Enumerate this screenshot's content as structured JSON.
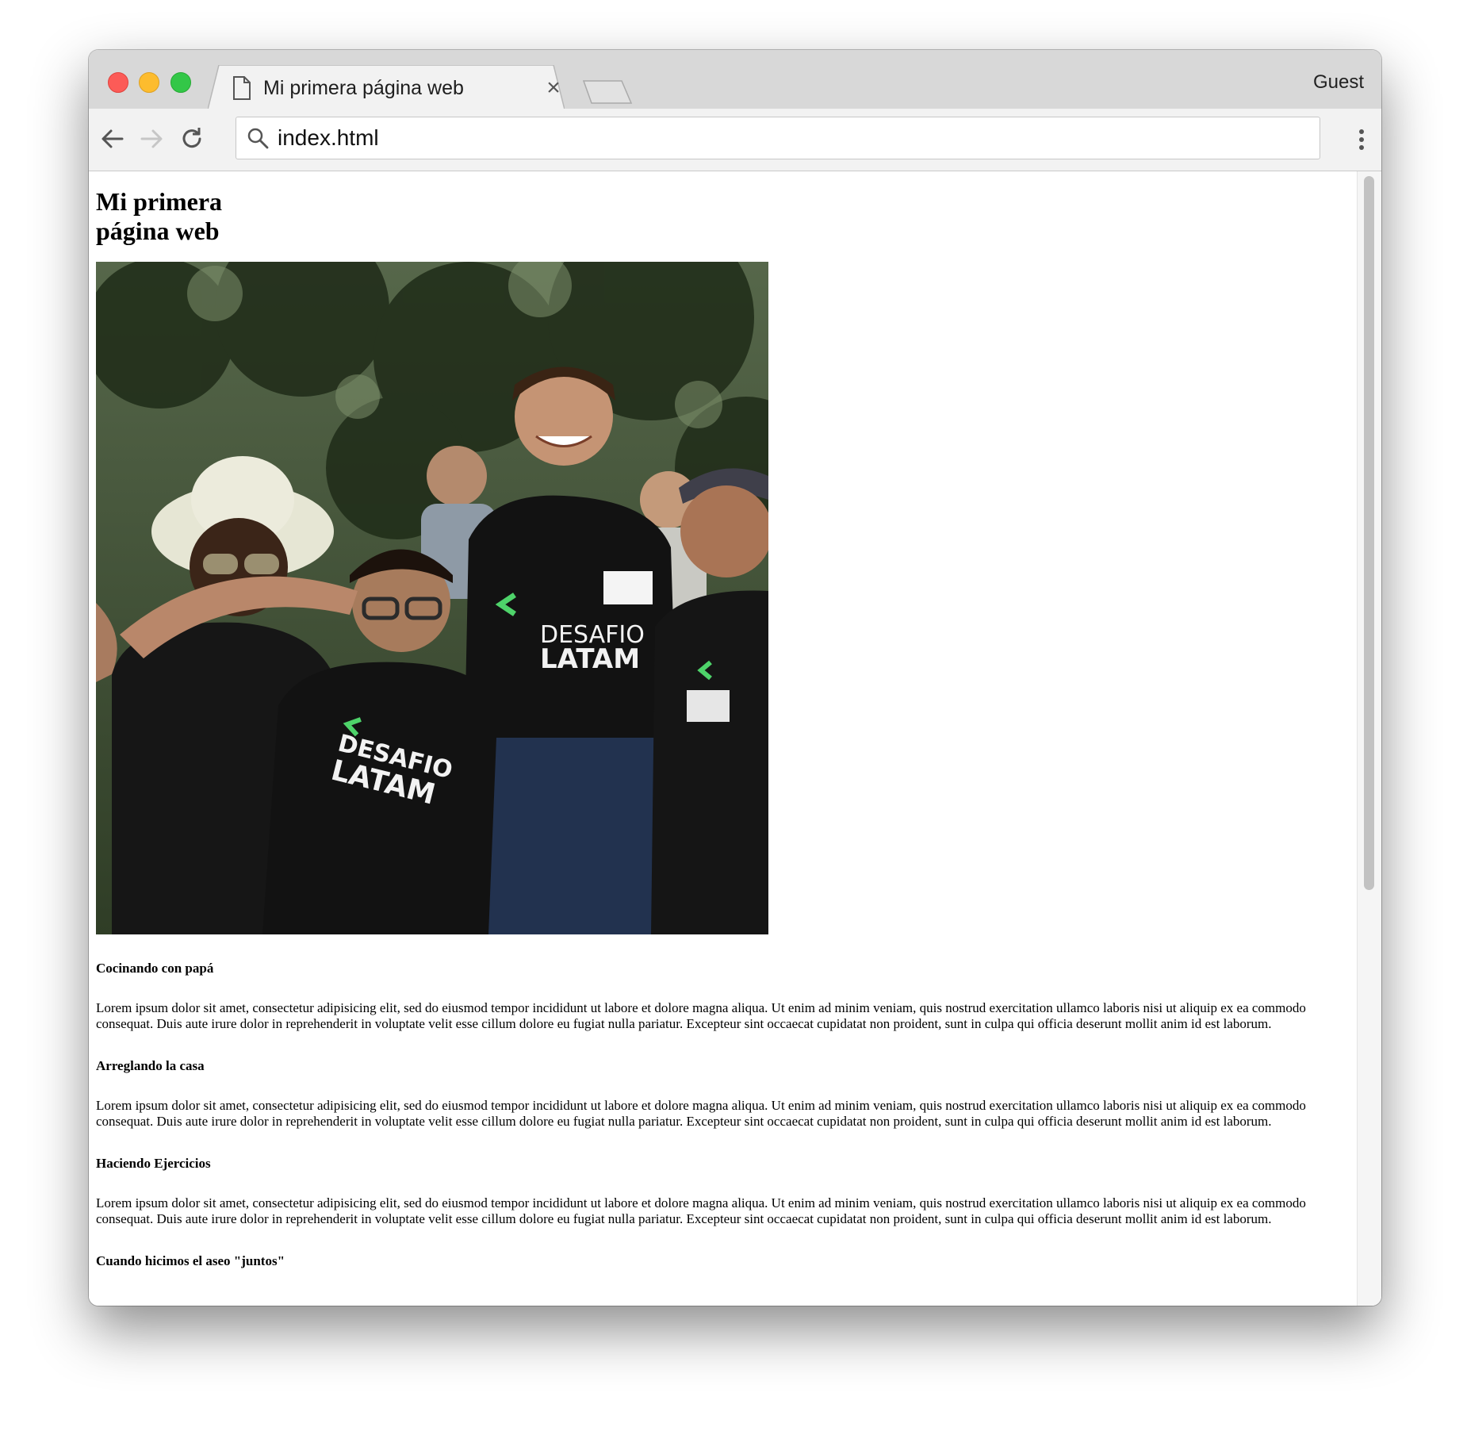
{
  "browser": {
    "tab_title": "Mi primera página web",
    "tab_close_symbol": "×",
    "profile_label": "Guest",
    "address_text": "index.html",
    "icons": [
      "close-window",
      "minimize-window",
      "zoom-window",
      "document-icon",
      "close-tab-icon",
      "back-arrow-icon",
      "forward-arrow-icon",
      "reload-icon",
      "search-icon",
      "more-vert-icon"
    ],
    "colors": {
      "chrome_bg": "#d8d8d8",
      "tab_bg": "#f2f2f2",
      "red": "#fc5b57",
      "yellow": "#fdbc2e",
      "green": "#33c748"
    }
  },
  "page": {
    "title": "Mi primera página web",
    "photo_text": [
      "DESAFIO",
      "LATAM"
    ],
    "sections": [
      {
        "heading": "Cocinando con papá",
        "text": "Lorem ipsum dolor sit amet, consectetur adipisicing elit, sed do eiusmod tempor incididunt ut labore et dolore magna aliqua. Ut enim ad minim veniam, quis nostrud exercitation ullamco laboris nisi ut aliquip ex ea commodo consequat. Duis aute irure dolor in reprehenderit in voluptate velit esse cillum dolore eu fugiat nulla pariatur. Excepteur sint occaecat cupidatat non proident, sunt in culpa qui officia deserunt mollit anim id est laborum."
      },
      {
        "heading": "Arreglando la casa",
        "text": "Lorem ipsum dolor sit amet, consectetur adipisicing elit, sed do eiusmod tempor incididunt ut labore et dolore magna aliqua. Ut enim ad minim veniam, quis nostrud exercitation ullamco laboris nisi ut aliquip ex ea commodo consequat. Duis aute irure dolor in reprehenderit in voluptate velit esse cillum dolore eu fugiat nulla pariatur. Excepteur sint occaecat cupidatat non proident, sunt in culpa qui officia deserunt mollit anim id est laborum."
      },
      {
        "heading": "Haciendo Ejercicios",
        "text": "Lorem ipsum dolor sit amet, consectetur adipisicing elit, sed do eiusmod tempor incididunt ut labore et dolore magna aliqua. Ut enim ad minim veniam, quis nostrud exercitation ullamco laboris nisi ut aliquip ex ea commodo consequat. Duis aute irure dolor in reprehenderit in voluptate velit esse cillum dolore eu fugiat nulla pariatur. Excepteur sint occaecat cupidatat non proident, sunt in culpa qui officia deserunt mollit anim id est laborum."
      },
      {
        "heading": "Cuando hicimos el aseo \"juntos\""
      }
    ]
  }
}
